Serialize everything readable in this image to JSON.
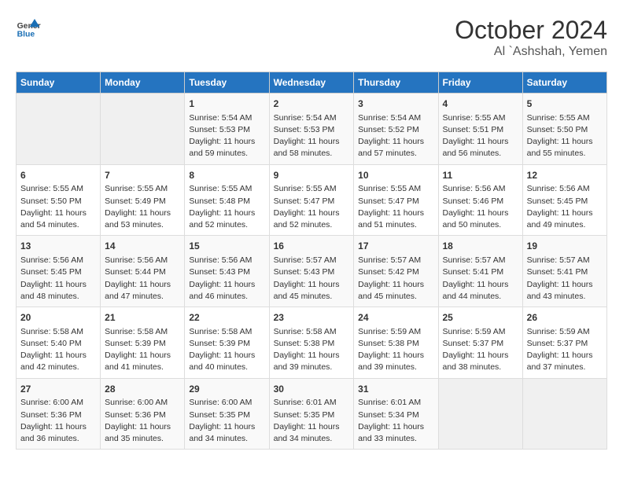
{
  "header": {
    "logo_general": "General",
    "logo_blue": "Blue",
    "title": "October 2024",
    "subtitle": "Al `Ashshah, Yemen"
  },
  "days_of_week": [
    "Sunday",
    "Monday",
    "Tuesday",
    "Wednesday",
    "Thursday",
    "Friday",
    "Saturday"
  ],
  "weeks": [
    [
      {
        "day": "",
        "info": ""
      },
      {
        "day": "",
        "info": ""
      },
      {
        "day": "1",
        "info": "Sunrise: 5:54 AM\nSunset: 5:53 PM\nDaylight: 11 hours and 59 minutes."
      },
      {
        "day": "2",
        "info": "Sunrise: 5:54 AM\nSunset: 5:53 PM\nDaylight: 11 hours and 58 minutes."
      },
      {
        "day": "3",
        "info": "Sunrise: 5:54 AM\nSunset: 5:52 PM\nDaylight: 11 hours and 57 minutes."
      },
      {
        "day": "4",
        "info": "Sunrise: 5:55 AM\nSunset: 5:51 PM\nDaylight: 11 hours and 56 minutes."
      },
      {
        "day": "5",
        "info": "Sunrise: 5:55 AM\nSunset: 5:50 PM\nDaylight: 11 hours and 55 minutes."
      }
    ],
    [
      {
        "day": "6",
        "info": "Sunrise: 5:55 AM\nSunset: 5:50 PM\nDaylight: 11 hours and 54 minutes."
      },
      {
        "day": "7",
        "info": "Sunrise: 5:55 AM\nSunset: 5:49 PM\nDaylight: 11 hours and 53 minutes."
      },
      {
        "day": "8",
        "info": "Sunrise: 5:55 AM\nSunset: 5:48 PM\nDaylight: 11 hours and 52 minutes."
      },
      {
        "day": "9",
        "info": "Sunrise: 5:55 AM\nSunset: 5:47 PM\nDaylight: 11 hours and 52 minutes."
      },
      {
        "day": "10",
        "info": "Sunrise: 5:55 AM\nSunset: 5:47 PM\nDaylight: 11 hours and 51 minutes."
      },
      {
        "day": "11",
        "info": "Sunrise: 5:56 AM\nSunset: 5:46 PM\nDaylight: 11 hours and 50 minutes."
      },
      {
        "day": "12",
        "info": "Sunrise: 5:56 AM\nSunset: 5:45 PM\nDaylight: 11 hours and 49 minutes."
      }
    ],
    [
      {
        "day": "13",
        "info": "Sunrise: 5:56 AM\nSunset: 5:45 PM\nDaylight: 11 hours and 48 minutes."
      },
      {
        "day": "14",
        "info": "Sunrise: 5:56 AM\nSunset: 5:44 PM\nDaylight: 11 hours and 47 minutes."
      },
      {
        "day": "15",
        "info": "Sunrise: 5:56 AM\nSunset: 5:43 PM\nDaylight: 11 hours and 46 minutes."
      },
      {
        "day": "16",
        "info": "Sunrise: 5:57 AM\nSunset: 5:43 PM\nDaylight: 11 hours and 45 minutes."
      },
      {
        "day": "17",
        "info": "Sunrise: 5:57 AM\nSunset: 5:42 PM\nDaylight: 11 hours and 45 minutes."
      },
      {
        "day": "18",
        "info": "Sunrise: 5:57 AM\nSunset: 5:41 PM\nDaylight: 11 hours and 44 minutes."
      },
      {
        "day": "19",
        "info": "Sunrise: 5:57 AM\nSunset: 5:41 PM\nDaylight: 11 hours and 43 minutes."
      }
    ],
    [
      {
        "day": "20",
        "info": "Sunrise: 5:58 AM\nSunset: 5:40 PM\nDaylight: 11 hours and 42 minutes."
      },
      {
        "day": "21",
        "info": "Sunrise: 5:58 AM\nSunset: 5:39 PM\nDaylight: 11 hours and 41 minutes."
      },
      {
        "day": "22",
        "info": "Sunrise: 5:58 AM\nSunset: 5:39 PM\nDaylight: 11 hours and 40 minutes."
      },
      {
        "day": "23",
        "info": "Sunrise: 5:58 AM\nSunset: 5:38 PM\nDaylight: 11 hours and 39 minutes."
      },
      {
        "day": "24",
        "info": "Sunrise: 5:59 AM\nSunset: 5:38 PM\nDaylight: 11 hours and 39 minutes."
      },
      {
        "day": "25",
        "info": "Sunrise: 5:59 AM\nSunset: 5:37 PM\nDaylight: 11 hours and 38 minutes."
      },
      {
        "day": "26",
        "info": "Sunrise: 5:59 AM\nSunset: 5:37 PM\nDaylight: 11 hours and 37 minutes."
      }
    ],
    [
      {
        "day": "27",
        "info": "Sunrise: 6:00 AM\nSunset: 5:36 PM\nDaylight: 11 hours and 36 minutes."
      },
      {
        "day": "28",
        "info": "Sunrise: 6:00 AM\nSunset: 5:36 PM\nDaylight: 11 hours and 35 minutes."
      },
      {
        "day": "29",
        "info": "Sunrise: 6:00 AM\nSunset: 5:35 PM\nDaylight: 11 hours and 34 minutes."
      },
      {
        "day": "30",
        "info": "Sunrise: 6:01 AM\nSunset: 5:35 PM\nDaylight: 11 hours and 34 minutes."
      },
      {
        "day": "31",
        "info": "Sunrise: 6:01 AM\nSunset: 5:34 PM\nDaylight: 11 hours and 33 minutes."
      },
      {
        "day": "",
        "info": ""
      },
      {
        "day": "",
        "info": ""
      }
    ]
  ]
}
